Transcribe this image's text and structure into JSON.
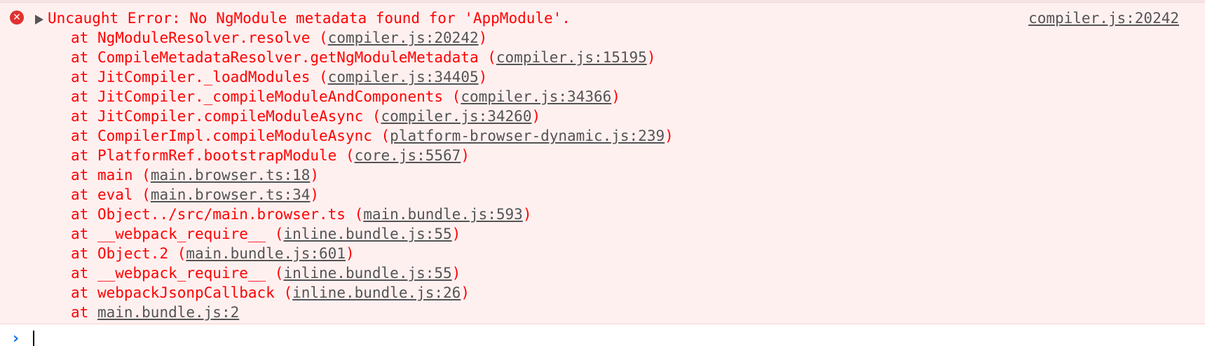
{
  "error": {
    "icon": "error-circle-icon",
    "expand_icon": "expand-triangle-icon",
    "message": "Uncaught Error: No NgModule metadata found for 'AppModule'.",
    "source_link": "compiler.js:20242",
    "stack": [
      {
        "prefix": "at ",
        "func": "NgModuleResolver.resolve",
        "file": "compiler.js:20242"
      },
      {
        "prefix": "at ",
        "func": "CompileMetadataResolver.getNgModuleMetadata",
        "file": "compiler.js:15195"
      },
      {
        "prefix": "at ",
        "func": "JitCompiler._loadModules",
        "file": "compiler.js:34405"
      },
      {
        "prefix": "at ",
        "func": "JitCompiler._compileModuleAndComponents",
        "file": "compiler.js:34366"
      },
      {
        "prefix": "at ",
        "func": "JitCompiler.compileModuleAsync",
        "file": "compiler.js:34260"
      },
      {
        "prefix": "at ",
        "func": "CompilerImpl.compileModuleAsync",
        "file": "platform-browser-dynamic.js:239"
      },
      {
        "prefix": "at ",
        "func": "PlatformRef.bootstrapModule",
        "file": "core.js:5567"
      },
      {
        "prefix": "at ",
        "func": "main",
        "file": "main.browser.ts:18"
      },
      {
        "prefix": "at ",
        "func": "eval",
        "file": "main.browser.ts:34"
      },
      {
        "prefix": "at ",
        "func": "Object../src/main.browser.ts",
        "file": "main.bundle.js:593"
      },
      {
        "prefix": "at ",
        "func": "__webpack_require__",
        "file": "inline.bundle.js:55"
      },
      {
        "prefix": "at ",
        "func": "Object.2",
        "file": "main.bundle.js:601"
      },
      {
        "prefix": "at ",
        "func": "__webpack_require__",
        "file": "inline.bundle.js:55"
      },
      {
        "prefix": "at ",
        "func": "webpackJsonpCallback",
        "file": "inline.bundle.js:26"
      },
      {
        "prefix": "at ",
        "func": "",
        "file": "main.bundle.js:2"
      }
    ]
  },
  "prompt": {
    "icon": "prompt-chevron-icon",
    "symbol": "›",
    "value": ""
  },
  "colors": {
    "error_text": "#ff0000",
    "error_background": "#fff0f0",
    "link_text": "#545454",
    "prompt_accent": "#1a73e8"
  }
}
